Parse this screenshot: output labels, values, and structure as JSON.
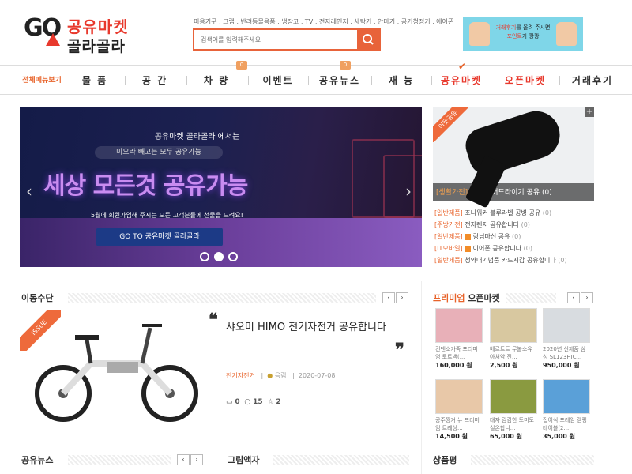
{
  "header": {
    "logo_go": "GO",
    "logo_line1": "공유마켓",
    "logo_line2": "골라골라",
    "keywords": "미용기구 , 그랩 , 반려동물용품 , 냉장고 , TV , 전자레인지 , 세탁기 , 안마기 , 공기청정기 , 에어폰",
    "search_placeholder": "검색어를 입력해주세요",
    "ad_text_1": "거래후기",
    "ad_text_2": "를 올려 주시면",
    "ad_text_3": "포인트",
    "ad_text_4": "가 쾅쾅"
  },
  "nav": {
    "all": "전체메뉴보기",
    "items": [
      {
        "label": "물 품"
      },
      {
        "label": "공 간"
      },
      {
        "label": "차 량",
        "badge": "0"
      },
      {
        "label": "이벤트"
      },
      {
        "label": "공유뉴스",
        "badge": "0"
      },
      {
        "label": "재 능"
      },
      {
        "label": "공유마켓"
      },
      {
        "label": "오픈마켓"
      },
      {
        "label": "거래후기"
      }
    ]
  },
  "slider": {
    "line1": "공유마켓 골라골라 에서는",
    "line2": "미오라 빼고는 모두 공유가능",
    "headline": "세상 모든것 공유가능",
    "line4": "5월에 회원가입해 주시는 모든 고객분들께 선물을 드려요!",
    "button": "GO TO 공유마켓 골라골라",
    "prev": "‹",
    "next": "›"
  },
  "spotlight": {
    "ribbon": "이웃공유",
    "category": "[생활가전]",
    "title": "헤어드라이기 공유",
    "count": "(0)",
    "plus": "+",
    "list": [
      {
        "cat": "[일반제품]",
        "text": "조니워커 블루라벨 공병 공유",
        "n": "(0)"
      },
      {
        "cat": "[주방가전]",
        "text": "전자렌지 공유합니다",
        "n": "(0)"
      },
      {
        "cat": "[일반제품]",
        "text": "랑님마신 공유",
        "n": "(0)",
        "icon": true
      },
      {
        "cat": "[IT모바일]",
        "text": "이어폰 공유합니다",
        "n": "(0)",
        "icon": true
      },
      {
        "cat": "[일반제품]",
        "text": "청와대기념품 카드지갑 공유합니다",
        "n": "(0)"
      }
    ]
  },
  "mobility": {
    "title": "이동수단",
    "issue": "ISSUE",
    "quote_open": "❝",
    "quote_close": "❞",
    "article_title": "샤오미 HIMO 전기자전거 공유합니다",
    "category": "전기자전거",
    "user": "음림",
    "date": "2020-07-08",
    "comments": "0",
    "views": "15",
    "likes": "2",
    "prev": "‹",
    "next": "›"
  },
  "premium": {
    "title_a": "프리미엄",
    "title_b": " 오픈마켓",
    "prev": "‹",
    "next": "›",
    "items": [
      {
        "title": "컨덴소가죽 프리미엄 토트백(...",
        "price": "160,000 원",
        "color": "#e8b0b8"
      },
      {
        "title": "베르트트 무불소유아처약 진...",
        "price": "2,500 원",
        "color": "#d8c8a0"
      },
      {
        "title": "2020년 신제품 삼성 SL123HIC...",
        "price": "950,000 원",
        "color": "#d8dce0"
      },
      {
        "title": "공주쨩거 뉴 프리미엄 트레싱...",
        "price": "14,500 원",
        "color": "#e8c8a8"
      },
      {
        "title": "대자 캄캄한 토미토 실온합니...",
        "price": "65,000 원",
        "color": "#8a9a40"
      },
      {
        "title": "접이식 프레임 캠핑테이블(2...",
        "price": "35,000 원",
        "color": "#5aa0d8"
      }
    ]
  },
  "bottom": {
    "news": "공유뉴스",
    "gallery": "그림액자",
    "review": "상품평",
    "prev": "‹",
    "next": "›"
  }
}
